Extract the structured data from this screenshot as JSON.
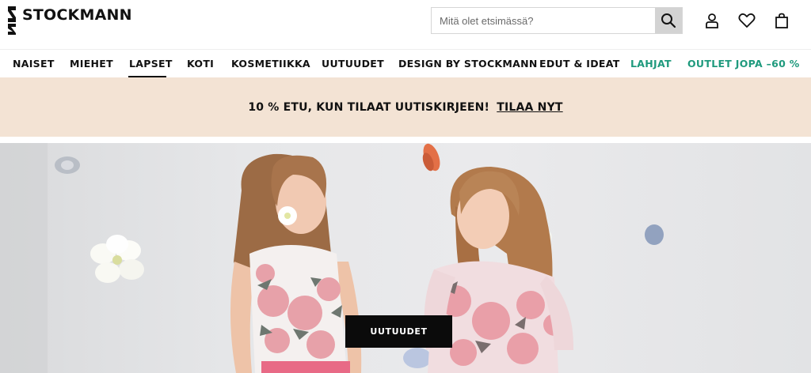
{
  "header": {
    "brand": "STOCKMANN",
    "search": {
      "placeholder": "Mitä olet etsimässä?",
      "value": ""
    },
    "icons": [
      "search-icon",
      "user-icon",
      "heart-icon",
      "bag-icon"
    ]
  },
  "nav": {
    "items": [
      {
        "label": "NAISET"
      },
      {
        "label": "MIEHET"
      },
      {
        "label": "LAPSET",
        "active": true
      },
      {
        "label": "KOTI"
      },
      {
        "label": "KOSMETIIKKA"
      },
      {
        "label": "UUTUUDET"
      },
      {
        "label": "DESIGN BY STOCKMANN"
      },
      {
        "label": "EDUT & IDEAT"
      },
      {
        "label": "LAHJAT",
        "accent": true
      },
      {
        "label": "OUTLET JOPA –60 %",
        "accent": true
      }
    ],
    "accent_color": "#1f9a7d"
  },
  "promo": {
    "text": "10 % ETU, KUN TILAAT UUTISKIRJEEN!",
    "link": "TILAA NYT",
    "background": "#f3e3d4"
  },
  "hero": {
    "cta": "UUTUUDET"
  }
}
